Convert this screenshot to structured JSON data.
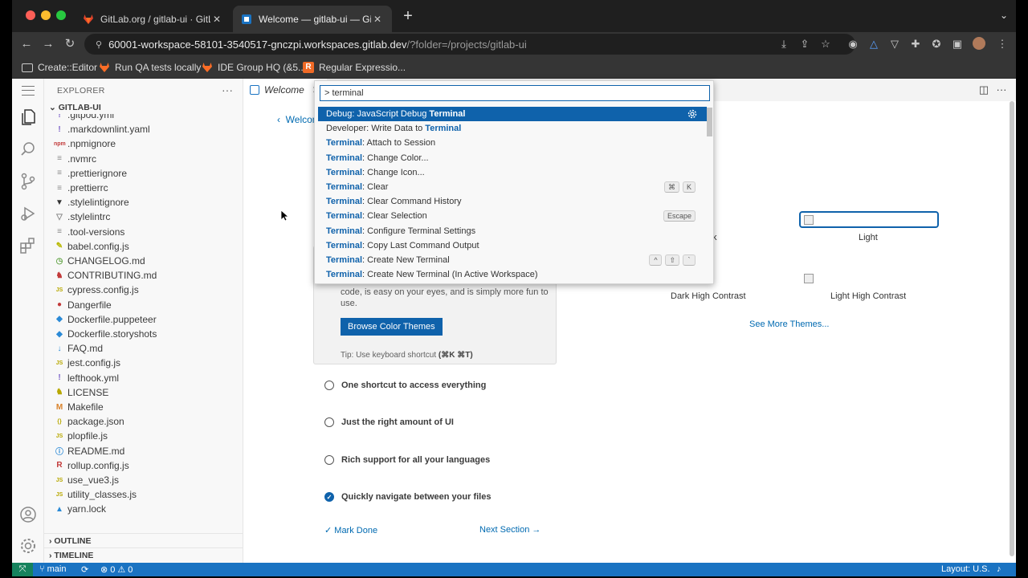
{
  "browser": {
    "tabs": [
      {
        "title": "GitLab.org / gitlab-ui · GitLab",
        "active": false
      },
      {
        "title": "Welcome — gitlab-ui — GitLab",
        "active": true
      }
    ],
    "url_host": "60001-workspace-58101-3540517-gnczpi.workspaces.gitlab.dev",
    "url_path": "/?folder=/projects/gitlab-ui",
    "bookmarks": [
      "Create::Editor",
      "Run QA tests locally",
      "IDE Group HQ (&5...",
      "Regular Expressio..."
    ]
  },
  "explorer": {
    "header": "EXPLORER",
    "workspace": "GITLAB-UI",
    "files": [
      {
        "name": ".gitpod.yml",
        "icon": "!",
        "color": "#7b61c8"
      },
      {
        "name": ".markdownlint.yaml",
        "icon": "!",
        "color": "#7b61c8"
      },
      {
        "name": ".npmignore",
        "icon": "npm",
        "color": "#c23a3a"
      },
      {
        "name": ".nvmrc",
        "icon": "≡",
        "color": "#8a8a8a"
      },
      {
        "name": ".prettierignore",
        "icon": "≡",
        "color": "#8a8a8a"
      },
      {
        "name": ".prettierrc",
        "icon": "≡",
        "color": "#8a8a8a"
      },
      {
        "name": ".stylelintignore",
        "icon": "▼",
        "color": "#333333"
      },
      {
        "name": ".stylelintrc",
        "icon": "▽",
        "color": "#8a8a8a"
      },
      {
        "name": ".tool-versions",
        "icon": "≡",
        "color": "#8a8a8a"
      },
      {
        "name": "babel.config.js",
        "icon": "✎",
        "color": "#b8b800"
      },
      {
        "name": "CHANGELOG.md",
        "icon": "◷",
        "color": "#6aa84f"
      },
      {
        "name": "CONTRIBUTING.md",
        "icon": "♞",
        "color": "#c23a3a"
      },
      {
        "name": "cypress.config.js",
        "icon": "JS",
        "color": "#b8a800"
      },
      {
        "name": "Dangerfile",
        "icon": "●",
        "color": "#c23a3a"
      },
      {
        "name": "Dockerfile.puppeteer",
        "icon": "◆",
        "color": "#2b8ad6"
      },
      {
        "name": "Dockerfile.storyshots",
        "icon": "◆",
        "color": "#2b8ad6"
      },
      {
        "name": "FAQ.md",
        "icon": "↓",
        "color": "#2b8ad6"
      },
      {
        "name": "jest.config.js",
        "icon": "JS",
        "color": "#b8a800"
      },
      {
        "name": "lefthook.yml",
        "icon": "!",
        "color": "#7b61c8"
      },
      {
        "name": "LICENSE",
        "icon": "♞",
        "color": "#b8a800"
      },
      {
        "name": "Makefile",
        "icon": "M",
        "color": "#d9822b"
      },
      {
        "name": "package.json",
        "icon": "{}",
        "color": "#b8a800"
      },
      {
        "name": "plopfile.js",
        "icon": "JS",
        "color": "#b8a800"
      },
      {
        "name": "README.md",
        "icon": "ⓘ",
        "color": "#2b8ad6"
      },
      {
        "name": "rollup.config.js",
        "icon": "R",
        "color": "#c23a3a"
      },
      {
        "name": "use_vue3.js",
        "icon": "JS",
        "color": "#b8a800"
      },
      {
        "name": "utility_classes.js",
        "icon": "JS",
        "color": "#b8a800"
      },
      {
        "name": "yarn.lock",
        "icon": "▲",
        "color": "#2b8ad6"
      }
    ],
    "outline": "OUTLINE",
    "timeline": "TIMELINE"
  },
  "editor": {
    "tab_label": "Welcome",
    "back_link": "Welcome",
    "theme_desc": "code, is easy on your eyes, and is simply more fun to use.",
    "browse_button": "Browse Color Themes",
    "tip_prefix": "Tip: Use keyboard shortcut ",
    "tip_shortcut": "(⌘K ⌘T)",
    "steps": [
      {
        "label": "One shortcut to access everything",
        "done": false
      },
      {
        "label": "Just the right amount of UI",
        "done": false
      },
      {
        "label": "Rich support for all your languages",
        "done": false
      },
      {
        "label": "Quickly navigate between your files",
        "done": true
      }
    ],
    "mark_done": "Mark Done",
    "next_section": "Next Section",
    "themes": {
      "dark_partial": "k",
      "light": "Light",
      "dark_hc": "Dark High Contrast",
      "light_hc": "Light High Contrast",
      "see_more": "See More Themes..."
    }
  },
  "palette": {
    "input_value": "> terminal",
    "commands": [
      {
        "pre": "Debug: JavaScript Debug ",
        "hl": "Terminal",
        "post": "",
        "selected": true,
        "keys": []
      },
      {
        "pre": "Developer: Write Data to ",
        "hl": "Terminal",
        "post": "",
        "selected": false,
        "keys": []
      },
      {
        "pre": "",
        "hl": "Terminal",
        "post": ": Attach to Session",
        "selected": false,
        "keys": []
      },
      {
        "pre": "",
        "hl": "Terminal",
        "post": ": Change Color...",
        "selected": false,
        "keys": []
      },
      {
        "pre": "",
        "hl": "Terminal",
        "post": ": Change Icon...",
        "selected": false,
        "keys": []
      },
      {
        "pre": "",
        "hl": "Terminal",
        "post": ": Clear",
        "selected": false,
        "keys": [
          "⌘",
          "K"
        ]
      },
      {
        "pre": "",
        "hl": "Terminal",
        "post": ": Clear Command History",
        "selected": false,
        "keys": []
      },
      {
        "pre": "",
        "hl": "Terminal",
        "post": ": Clear Selection",
        "selected": false,
        "keys": [
          "Escape"
        ]
      },
      {
        "pre": "",
        "hl": "Terminal",
        "post": ": Configure Terminal Settings",
        "selected": false,
        "keys": []
      },
      {
        "pre": "",
        "hl": "Terminal",
        "post": ": Copy Last Command Output",
        "selected": false,
        "keys": []
      },
      {
        "pre": "",
        "hl": "Terminal",
        "post": ": Create New Terminal",
        "selected": false,
        "keys": [
          "^",
          "⇧",
          "`"
        ]
      },
      {
        "pre": "",
        "hl": "Terminal",
        "post": ": Create New Terminal (In Active Workspace)",
        "selected": false,
        "keys": []
      }
    ]
  },
  "statusbar": {
    "branch": "main",
    "errors": "0",
    "warnings": "0",
    "layout": "Layout: U.S."
  }
}
